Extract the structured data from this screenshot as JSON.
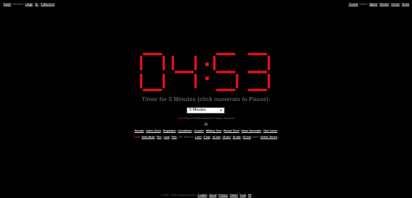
{
  "top_left": {
    "small": "Small",
    "medium": "Medium",
    "large": "Large",
    "xl": "XL",
    "fullscreen": "Fullscreen"
  },
  "top_right": {
    "clouds": "Clouds",
    "black": "Black",
    "space": "Space",
    "woods": "Woods",
    "ocean": "Ocean",
    "snow": "Snow"
  },
  "clock": {
    "time": "04:53",
    "digit_color": "#e8141b",
    "background": "#000000"
  },
  "timer_title": "Timer for 5 Minutes (click numerals to Pause):",
  "duration_select": {
    "value": "5 Minutes"
  },
  "hint": {
    "prefix": "[ ",
    "new": "New",
    "text": " Click on Timer numbers to Pause / Resume ]"
  },
  "tools_row": {
    "bracket_open": "[",
    "links": [
      "Sounds",
      "Alarm Clock",
      "Stopwatch",
      "Countdown",
      "Counter",
      "Military Time",
      "Round Timer",
      "Noise Generator",
      "Time Zones"
    ],
    "bracket_close": "]"
  },
  "options_row": {
    "new_label": "[ New:",
    "links_a": [
      "Dark Mode",
      "Fire",
      "Lava",
      "Fish"
    ],
    "set_timer_label": "Set Timer for:",
    "times": [
      "1 min",
      "5 min",
      "10 min",
      "15 min",
      "30 min",
      "60 min"
    ],
    "more_label": "More:",
    "more_link": "Online Timers",
    "bracket_close": "]"
  },
  "footer": {
    "copyright": "© 2005 - 2026 OnlineClock.net",
    "links": [
      "Contact",
      "About",
      "Privacy",
      "Twitter",
      "Insta",
      "FB"
    ]
  },
  "icons": {
    "eye": "eye-icon",
    "select_arrow": "chevron-down-icon"
  }
}
